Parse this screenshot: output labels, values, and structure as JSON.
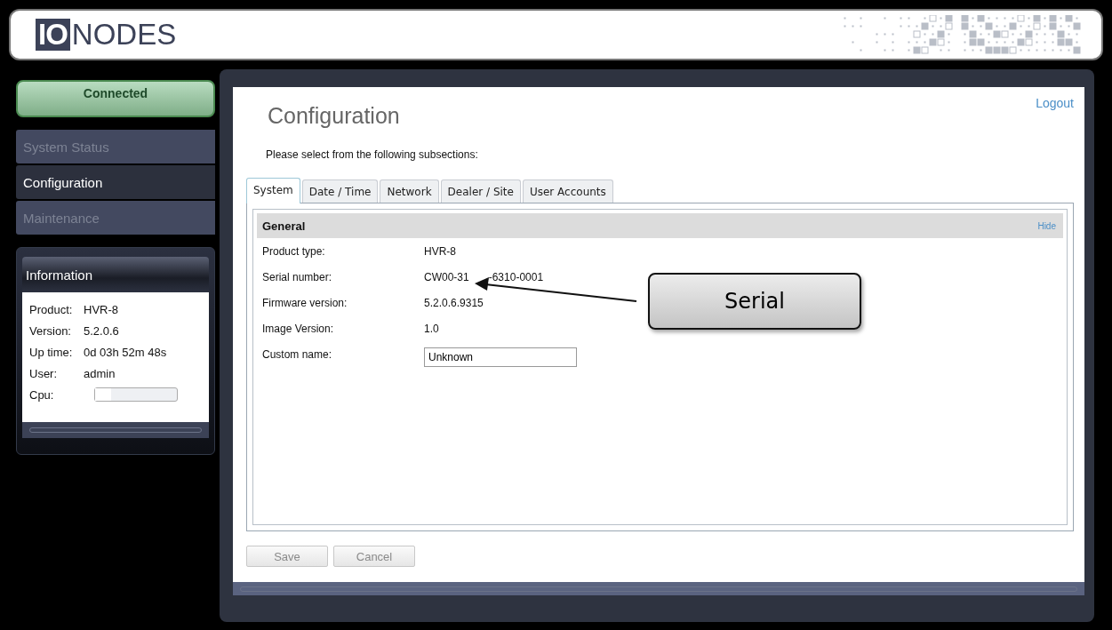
{
  "header": {
    "logo_mark": "IO",
    "logo_text": "NODES"
  },
  "sidebar": {
    "status": "Connected",
    "items": [
      {
        "label": "System Status",
        "selected": false
      },
      {
        "label": "Configuration",
        "selected": true
      },
      {
        "label": "Maintenance",
        "selected": false
      }
    ],
    "information": {
      "title": "Information",
      "rows": [
        {
          "label": "Product:",
          "value": "HVR-8"
        },
        {
          "label": "Version:",
          "value": "5.2.0.6"
        },
        {
          "label": "Up time:",
          "value": "0d 03h 52m 48s"
        },
        {
          "label": "User:",
          "value": "admin"
        }
      ],
      "cpu": {
        "label": "Cpu:",
        "level": 0.2
      }
    }
  },
  "main": {
    "logout": "Logout",
    "title": "Configuration",
    "intro": "Please select from the following subsections:",
    "tabs": [
      {
        "label": "System",
        "selected": true
      },
      {
        "label": "Date / Time",
        "selected": false
      },
      {
        "label": "Network",
        "selected": false
      },
      {
        "label": "Dealer / Site",
        "selected": false
      },
      {
        "label": "User Accounts",
        "selected": false
      }
    ],
    "section": {
      "title": "General",
      "hide": "Hide",
      "rows": [
        {
          "kind": "text",
          "label": "Product type:",
          "value": "HVR-8"
        },
        {
          "kind": "split",
          "label": "Serial number:",
          "value_start": "CW00-31",
          "value_end": "-6310-0001"
        },
        {
          "kind": "text",
          "label": "Firmware version:",
          "value": "5.2.0.6.9315"
        },
        {
          "kind": "text",
          "label": "Image Version:",
          "value": "1.0"
        },
        {
          "kind": "input",
          "label": "Custom name:",
          "value": "Unknown"
        }
      ]
    },
    "buttons": [
      {
        "label": "Save",
        "disabled": true
      },
      {
        "label": "Cancel",
        "disabled": true
      }
    ]
  },
  "callout": {
    "text": "Serial"
  }
}
